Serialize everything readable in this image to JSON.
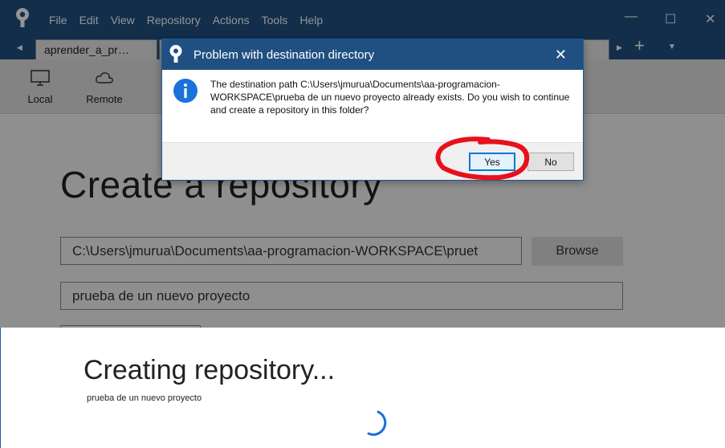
{
  "menu": [
    "File",
    "Edit",
    "View",
    "Repository",
    "Actions",
    "Tools",
    "Help"
  ],
  "window_controls": {
    "minimize": "—",
    "maximize": "☐",
    "close": "✕"
  },
  "tabs": [
    "aprender_a_pr…"
  ],
  "toolbar": {
    "local_label": "Local",
    "remote_label": "Remote"
  },
  "create": {
    "title": "Create a repository",
    "path_value": "C:\\Users\\jmurua\\Documents\\aa-programacion-WORKSPACE\\pruet",
    "name_value": "prueba de un nuevo proyecto",
    "browse_label": "Browse"
  },
  "dialog": {
    "title": "Problem with destination directory",
    "message": "The destination path C:\\Users\\jmurua\\Documents\\aa-programacion-WORKSPACE\\prueba de un nuevo proyecto already exists. Do you wish to continue and create a repository in this folder?",
    "yes_label": "Yes",
    "no_label": "No",
    "close": "✕"
  },
  "progress": {
    "title": "Creating repository...",
    "subtitle": "prueba de un nuevo proyecto"
  },
  "colors": {
    "titlebar": "#205081",
    "annotation": "#e8101c",
    "spinner": "#1a6fd6"
  }
}
